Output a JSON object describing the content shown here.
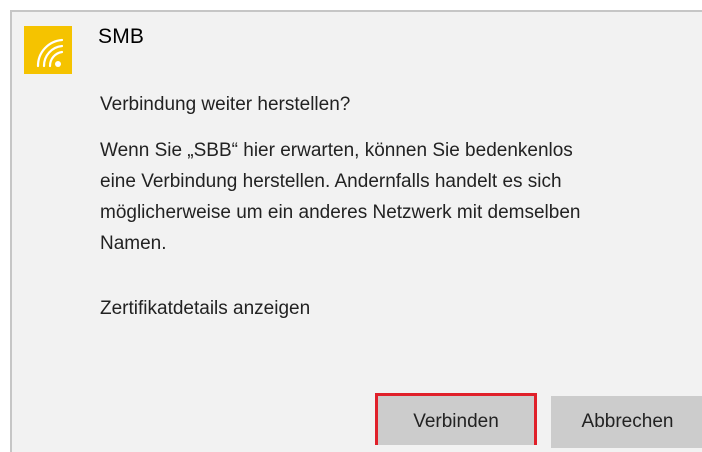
{
  "dialog": {
    "title": "SMB",
    "icon": "wifi-icon",
    "accent_color": "#f5c300",
    "question": "Verbindung weiter herstellen?",
    "body_lines": [
      "Wenn Sie „SBB“ hier erwarten, können Sie bedenkenlos",
      "eine Verbindung herstellen. Andernfalls handelt es sich",
      "möglicherweise um ein anderes Netzwerk mit demselben",
      "Namen."
    ],
    "cert_link": "Zertifikatdetails anzeigen",
    "buttons": {
      "connect": "Verbinden",
      "cancel": "Abbrechen"
    },
    "highlight_color": "#e0202a"
  }
}
